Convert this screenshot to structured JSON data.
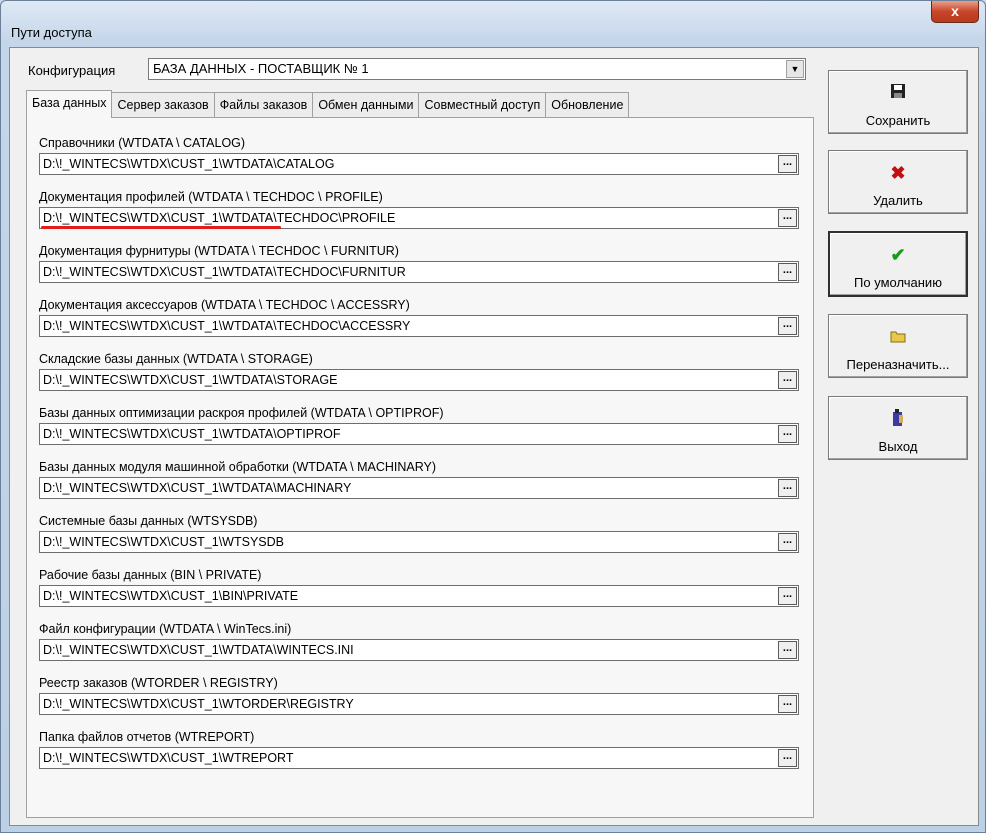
{
  "window": {
    "title": "Пути доступа",
    "close_label": "x"
  },
  "config": {
    "label": "Конфигурация",
    "value": "БАЗА ДАННЫХ - ПОСТАВЩИК № 1"
  },
  "tabs": [
    {
      "label": "База данных",
      "active": true
    },
    {
      "label": "Сервер заказов"
    },
    {
      "label": "Файлы заказов"
    },
    {
      "label": "Обмен данными"
    },
    {
      "label": "Совместный доступ"
    },
    {
      "label": "Обновление"
    }
  ],
  "paths": [
    {
      "label": "Справочники (WTDATA \\ CATALOG)",
      "value": "D:\\!_WINTECS\\WTDX\\CUST_1\\WTDATA\\CATALOG"
    },
    {
      "label": "Документация профилей (WTDATA \\ TECHDOC \\ PROFILE)",
      "value": "D:\\!_WINTECS\\WTDX\\CUST_1\\WTDATA\\TECHDOC\\PROFILE"
    },
    {
      "label": "Документация фурнитуры (WTDATA \\ TECHDOC \\ FURNITUR)",
      "value": "D:\\!_WINTECS\\WTDX\\CUST_1\\WTDATA\\TECHDOC\\FURNITUR"
    },
    {
      "label": "Документация аксессуаров (WTDATA \\ TECHDOC \\ ACCESSRY)",
      "value": "D:\\!_WINTECS\\WTDX\\CUST_1\\WTDATA\\TECHDOC\\ACCESSRY"
    },
    {
      "label": "Складские базы данных  (WTDATA \\ STORAGE)",
      "value": "D:\\!_WINTECS\\WTDX\\CUST_1\\WTDATA\\STORAGE"
    },
    {
      "label": "Базы данных оптимизации раскроя профилей (WTDATA \\ OPTIPROF)",
      "value": "D:\\!_WINTECS\\WTDX\\CUST_1\\WTDATA\\OPTIPROF"
    },
    {
      "label": "Базы данных модуля машинной обработки (WTDATA \\ MACHINARY)",
      "value": "D:\\!_WINTECS\\WTDX\\CUST_1\\WTDATA\\MACHINARY"
    },
    {
      "label": "Системные базы данных (WTSYSDB)",
      "value": "D:\\!_WINTECS\\WTDX\\CUST_1\\WTSYSDB"
    },
    {
      "label": "Рабочие базы  данных (BIN \\ PRIVATE)",
      "value": "D:\\!_WINTECS\\WTDX\\CUST_1\\BIN\\PRIVATE"
    },
    {
      "label": "Файл конфигурации (WTDATA \\ WinTecs.ini)",
      "value": "D:\\!_WINTECS\\WTDX\\CUST_1\\WTDATA\\WINTECS.INI"
    },
    {
      "label": "Реестр заказов (WTORDER \\ REGISTRY)",
      "value": "D:\\!_WINTECS\\WTDX\\CUST_1\\WTORDER\\REGISTRY"
    },
    {
      "label": "Папка файлов отчетов (WTREPORT)",
      "value": "D:\\!_WINTECS\\WTDX\\CUST_1\\WTREPORT"
    }
  ],
  "browse_label": "...",
  "buttons": {
    "save": "Сохранить",
    "delete": "Удалить",
    "default": "По умолчанию",
    "reassign": "Переназначить...",
    "exit": "Выход"
  },
  "icons": {
    "save": "floppy-disk-icon",
    "delete": "red-x-icon",
    "default": "green-check-icon",
    "reassign": "folder-icon",
    "exit": "door-exit-icon"
  },
  "colors": {
    "underline": "#e51c1c",
    "check": "#1a9a1a",
    "delete": "#c01010"
  }
}
